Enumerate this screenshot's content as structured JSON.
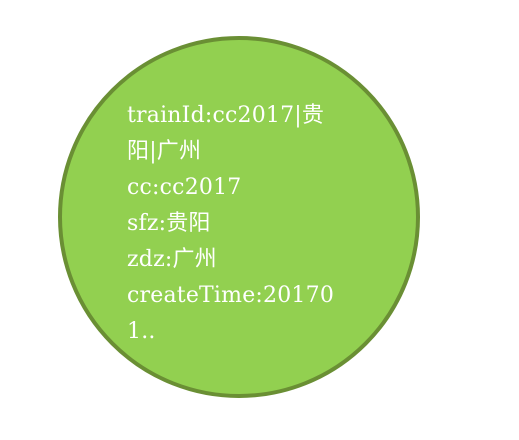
{
  "node": {
    "lines": [
      "trainId:cc2017|贵",
      "阳|广州",
      "cc:cc2017",
      "sfz:贵阳",
      "zdz:广州",
      "createTime:20170",
      "1.."
    ],
    "fill_color": "#92d050",
    "stroke_color": "#6a8f34",
    "text_color": "#ffffff"
  }
}
